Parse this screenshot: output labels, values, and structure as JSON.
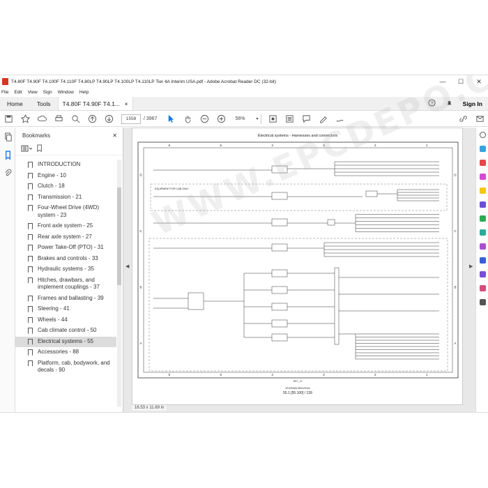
{
  "window": {
    "title": "T4.80F T4.90F T4.100F T4.110F T4.80LP T4.90LP T4.100LP T4.110LP Tier 4A Interim USA.pdf - Adobe Acrobat Reader DC (32-bit)",
    "minimize": "—",
    "maximize": "☐",
    "close": "✕"
  },
  "menu": [
    "File",
    "Edit",
    "View",
    "Sign",
    "Window",
    "Help"
  ],
  "tabs": {
    "home": "Home",
    "tools": "Tools",
    "doc": "T4.80F T4.90F T4.1...",
    "doc_close": "×",
    "sign_in": "Sign In"
  },
  "toolbar": {
    "page_current": "1558",
    "page_total": "/ 3967",
    "zoom": "56%"
  },
  "bookmarks": {
    "title": "Bookmarks",
    "close": "✕",
    "items": [
      {
        "label": "INTRODUCTION"
      },
      {
        "label": "Engine - 10"
      },
      {
        "label": "Clutch - 18"
      },
      {
        "label": "Transmission - 21"
      },
      {
        "label": "Four-Wheel Drive (4WD) system - 23"
      },
      {
        "label": "Front axle system - 25"
      },
      {
        "label": "Rear axle system - 27"
      },
      {
        "label": "Power Take-Off (PTO) - 31"
      },
      {
        "label": "Brakes and controls - 33"
      },
      {
        "label": "Hydraulic systems - 35"
      },
      {
        "label": "Hitches, drawbars, and implement couplings - 37"
      },
      {
        "label": "Frames and ballasting - 39"
      },
      {
        "label": "Steering - 41"
      },
      {
        "label": "Wheels - 44"
      },
      {
        "label": "Cab climate control - 50"
      },
      {
        "label": "Electrical systems - 55",
        "selected": true
      },
      {
        "label": "Accessories - 88"
      },
      {
        "label": "Platform, cab, bodywork, and decals - 90"
      }
    ]
  },
  "page": {
    "heading": "Electrical systems - Harnesses and connectors",
    "columns": [
      "6",
      "5",
      "4",
      "3",
      "2",
      "1"
    ],
    "rows": [
      "D",
      "C",
      "B",
      "A"
    ],
    "box_label": "EQUIPMENT FOR CAB ONLY",
    "footer_code": "87429328  28/11/2016",
    "footer_page": "55.1 [55.100] / 139"
  },
  "status": {
    "size": "16.53 x 11.69 in"
  },
  "watermark": "WWW.EPCDEPO.COM",
  "colors": {
    "accent": "#1473e6",
    "pdf_red": "#d32f2f"
  }
}
